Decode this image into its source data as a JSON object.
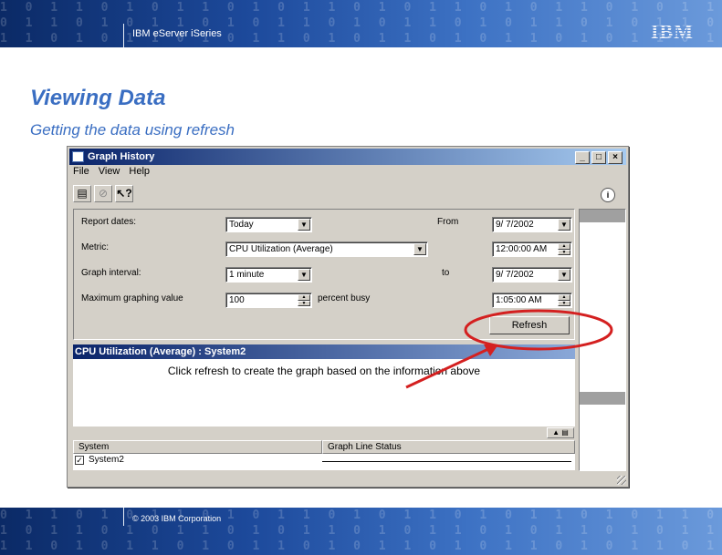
{
  "header": {
    "title": "IBM eServer iSeries",
    "logo": "IBM"
  },
  "footer": {
    "copyright": "© 2003 IBM Corporation"
  },
  "slide": {
    "title": "Viewing Data",
    "subtitle": "Getting the data using refresh"
  },
  "window": {
    "title": "Graph History",
    "controls": [
      "_",
      "□",
      "×"
    ],
    "menu": [
      "File",
      "View",
      "Help"
    ],
    "toolbar_icons": [
      "properties-icon",
      "stop-icon",
      "help-pointer-icon"
    ],
    "report_dates_label": "Report dates:",
    "report_dates_value": "Today",
    "metric_label": "Metric:",
    "metric_value": "CPU Utilization (Average)",
    "graph_interval_label": "Graph interval:",
    "graph_interval_value": "1 minute",
    "max_graph_label": "Maximum graphing value",
    "max_graph_value": "100",
    "max_graph_unit": "percent busy",
    "from_label": "From",
    "from_date": "9/ 7/2002",
    "from_time": "12:00:00 AM",
    "to_label": "to",
    "to_date": "9/ 7/2002",
    "to_time": "1:05:00 AM",
    "refresh_label": "Refresh",
    "graph_header": "CPU Utilization (Average) : System2",
    "graph_message": "Click refresh to create the graph based on the information above",
    "list_columns": [
      "System",
      "Graph Line Status"
    ],
    "list_rows": [
      {
        "system": "System2",
        "status": "",
        "checked": true
      }
    ]
  },
  "annotation_color": "#d42020"
}
